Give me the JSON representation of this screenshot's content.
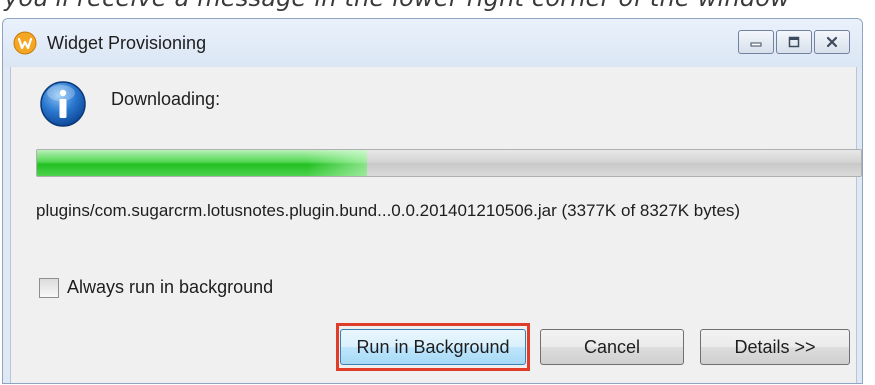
{
  "page_top_strip": "you'll receive a message in the lower right corner of the window",
  "window": {
    "title": "Widget Provisioning",
    "icon": "widget-provisioning-app-icon",
    "caption_buttons": [
      "minimize-icon",
      "maximize-icon",
      "close-icon"
    ]
  },
  "dialog": {
    "status_icon": "info-icon",
    "message": "Downloading:",
    "progress_fraction": 0.4,
    "detail": "plugins/com.sugarcrm.lotusnotes.plugin.bund...0.0.201401210506.jar (3377K of 8327K bytes)",
    "always_background": {
      "label": "Always run in background",
      "checked": false
    }
  },
  "buttons": {
    "run_in_background": "Run in Background",
    "cancel": "Cancel",
    "details": "Details >>"
  },
  "colors": {
    "progress_green": "#22c022",
    "highlight_red": "#e03c2a",
    "default_button_border": "#3c7fb1"
  }
}
